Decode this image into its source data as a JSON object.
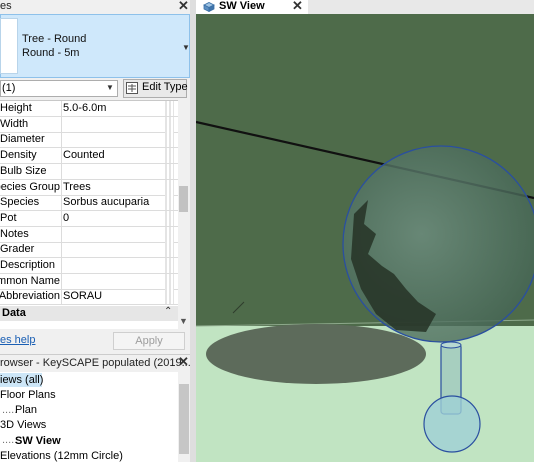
{
  "properties": {
    "title": "es",
    "type_line1": "Tree - Round",
    "type_line2": "Round - 5m",
    "instance": "(1)",
    "edit_type": "Edit Type",
    "rows": [
      {
        "name": "Height",
        "value": "5.0-6.0m"
      },
      {
        "name": "Width",
        "value": ""
      },
      {
        "name": "Diameter",
        "value": ""
      },
      {
        "name": "Density",
        "value": "Counted"
      },
      {
        "name": "Bulb Size",
        "value": ""
      },
      {
        "name": "Species Group",
        "value": "Trees"
      },
      {
        "name": "Species",
        "value": "Sorbus aucuparia"
      },
      {
        "name": "Pot",
        "value": "0"
      },
      {
        "name": "Notes",
        "value": ""
      },
      {
        "name": "Grader",
        "value": ""
      },
      {
        "name": "Description",
        "value": ""
      },
      {
        "name": "Common Name",
        "value": ""
      },
      {
        "name": "Abbreviation",
        "value": "SORAU"
      }
    ],
    "section": "Data",
    "help_link": "es help",
    "apply": "Apply"
  },
  "browser": {
    "title": "rowser - KeySCAPE populated (2019...",
    "items": [
      "iews (all)",
      "Floor Plans",
      "Plan",
      "3D Views",
      "SW View",
      "Elevations (12mm Circle)"
    ]
  },
  "view": {
    "tab_label": "SW View"
  },
  "icons": {
    "close": "close-icon",
    "edit_type": "edit-type-icon",
    "dropdown": "chevron-down-icon",
    "collapse": "collapse-icon",
    "view3d": "3d-view-icon"
  },
  "colors": {
    "wall": "#4e6b4a",
    "ground": "#c1e4c2",
    "selection": "#cfe8fb",
    "link": "#1a5fb4"
  }
}
